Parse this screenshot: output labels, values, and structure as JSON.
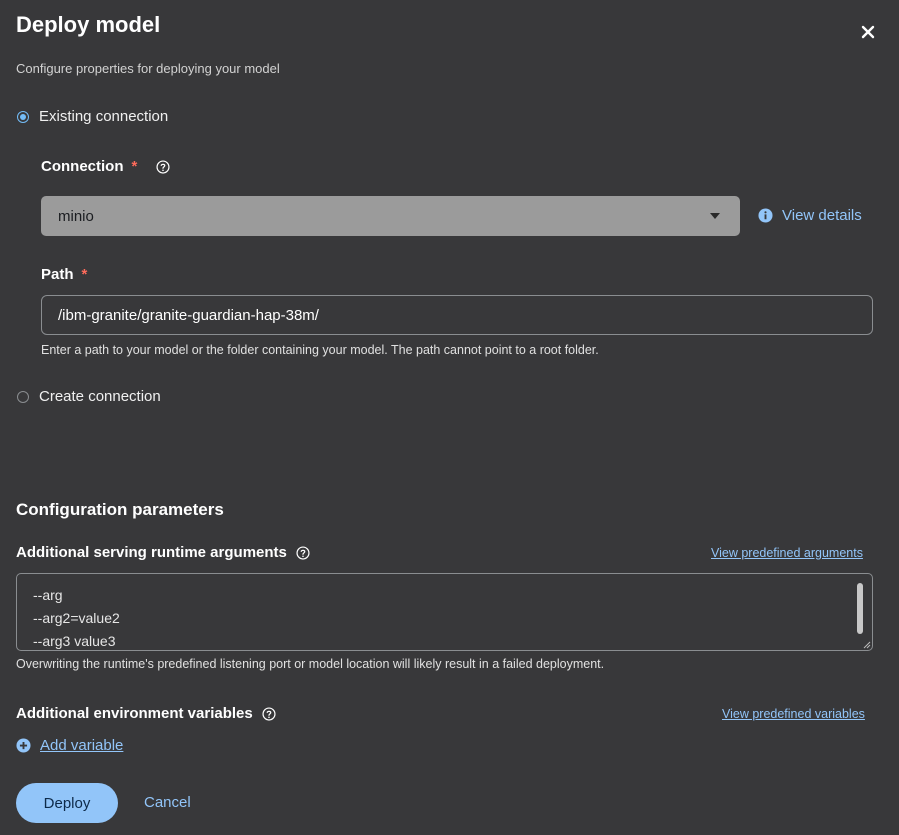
{
  "modal": {
    "title": "Deploy model",
    "subtitle": "Configure properties for deploying your model"
  },
  "connection_options": {
    "existing": "Existing connection",
    "create": "Create connection",
    "selected": "existing"
  },
  "connection": {
    "label": "Connection",
    "required_mark": "*",
    "value": "minio",
    "view_details": "View details"
  },
  "path": {
    "label": "Path",
    "required_mark": "*",
    "value": "/ibm-granite/granite-guardian-hap-38m/",
    "helper": "Enter a path to your model or the folder containing your model. The path cannot point to a root folder."
  },
  "config": {
    "section_title": "Configuration parameters",
    "runtime_args_label": "Additional serving runtime arguments",
    "view_predefined_args": "View predefined arguments",
    "runtime_args_lines": [
      "--arg",
      "--arg2=value2",
      "--arg3 value3"
    ],
    "runtime_args_helper": "Overwriting the runtime's predefined listening port or model location will likely result in a failed deployment.",
    "env_vars_label": "Additional environment variables",
    "view_predefined_vars": "View predefined variables",
    "add_variable": "Add variable"
  },
  "actions": {
    "deploy": "Deploy",
    "cancel": "Cancel"
  },
  "colors": {
    "background": "#38383a",
    "accent": "#92c5f9",
    "required": "#ff6b5b"
  }
}
